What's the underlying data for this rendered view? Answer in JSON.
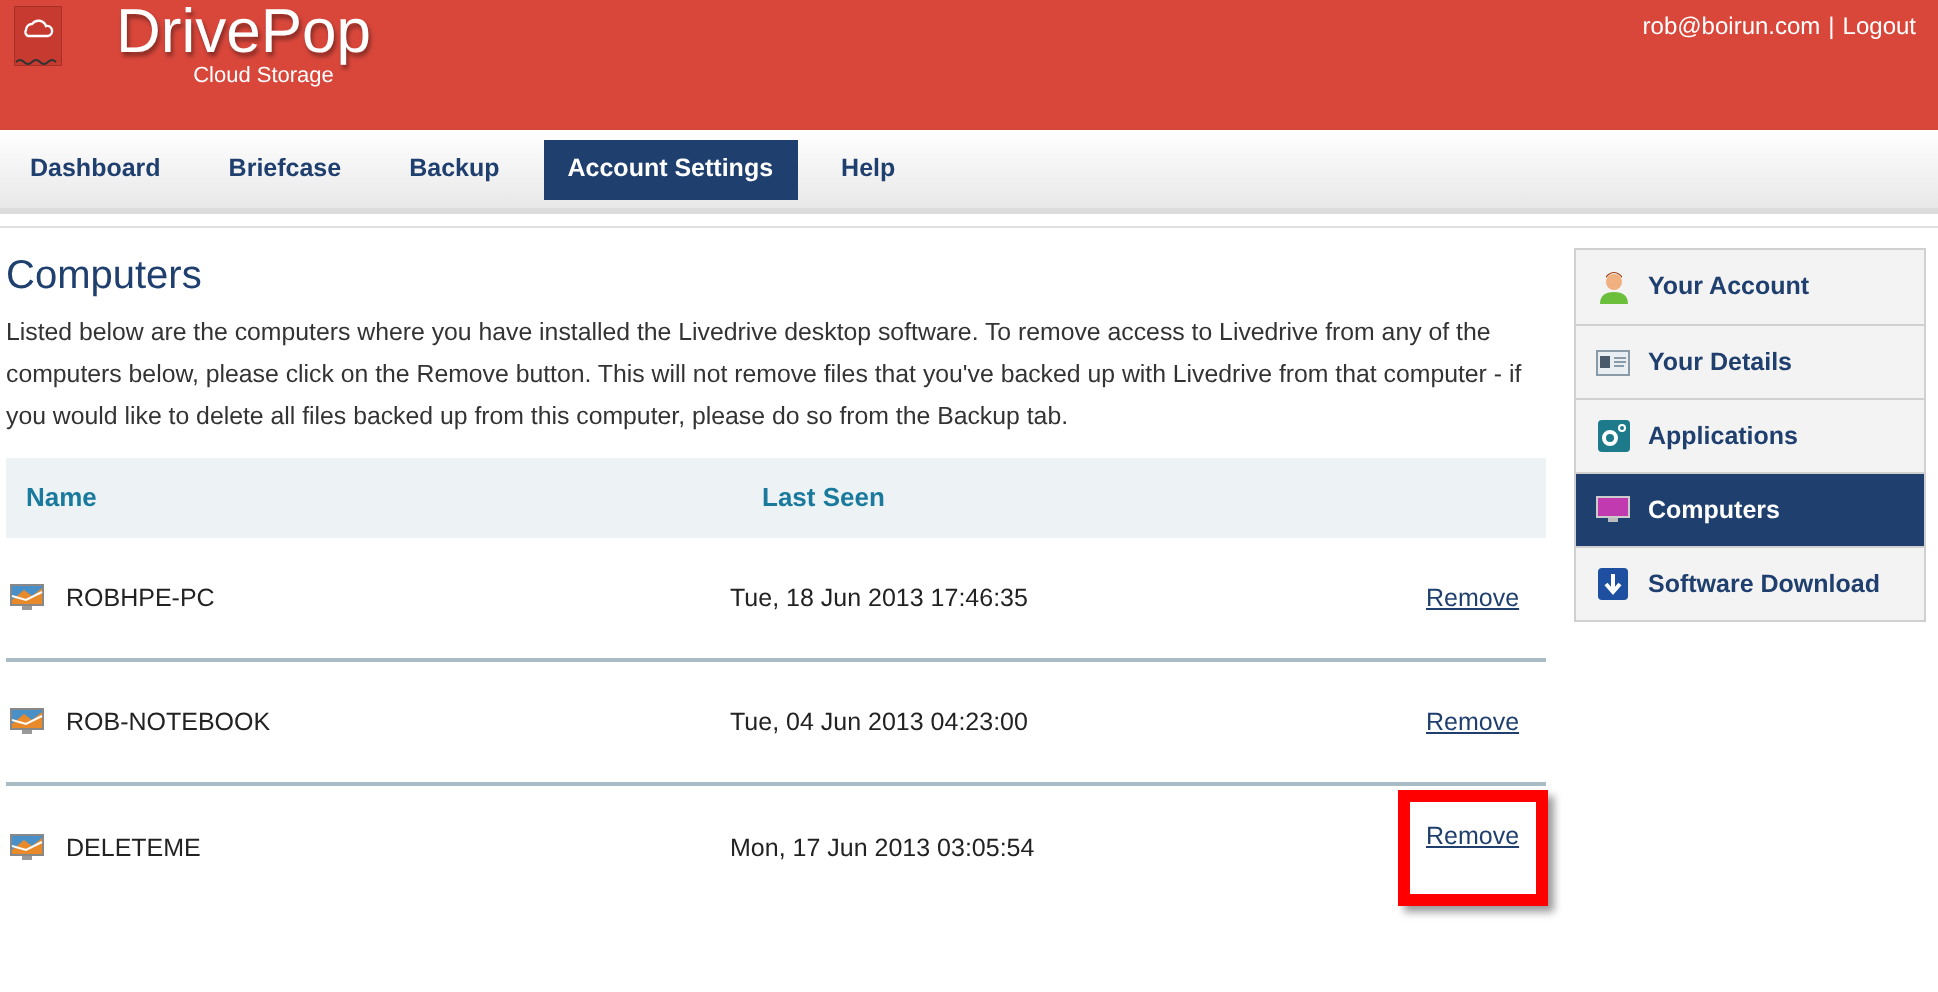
{
  "header": {
    "brand": "DrivePop",
    "tagline": "Cloud Storage",
    "user": "rob@boirun.com",
    "separator": "|",
    "logout": "Logout"
  },
  "tabs": [
    {
      "label": "Dashboard",
      "selected": false
    },
    {
      "label": "Briefcase",
      "selected": false
    },
    {
      "label": "Backup",
      "selected": false
    },
    {
      "label": "Account Settings",
      "selected": true
    },
    {
      "label": "Help",
      "selected": false
    }
  ],
  "page": {
    "title": "Computers",
    "description": "Listed below are the computers where you have installed the Livedrive desktop software. To remove access to Livedrive from any of the computers below, please click on the Remove button. This will not remove files that you've backed up with Livedrive from that computer - if you would like to delete all files backed up from this computer, please do so from the Backup tab."
  },
  "table": {
    "columns": [
      "Name",
      "Last Seen"
    ],
    "rows": [
      {
        "name": "ROBHPE-PC",
        "last_seen": "Tue, 18 Jun 2013 17:46:35",
        "action": "Remove",
        "highlighted": false
      },
      {
        "name": "ROB-NOTEBOOK",
        "last_seen": "Tue, 04 Jun 2013 04:23:00",
        "action": "Remove",
        "highlighted": false
      },
      {
        "name": "DELETEME",
        "last_seen": "Mon, 17 Jun 2013 03:05:54",
        "action": "Remove",
        "highlighted": true
      }
    ]
  },
  "sidebar": {
    "items": [
      {
        "label": "Your Account",
        "selected": false
      },
      {
        "label": "Your Details",
        "selected": false
      },
      {
        "label": "Applications",
        "selected": false
      },
      {
        "label": "Computers",
        "selected": true
      },
      {
        "label": "Software Download",
        "selected": false
      }
    ]
  }
}
